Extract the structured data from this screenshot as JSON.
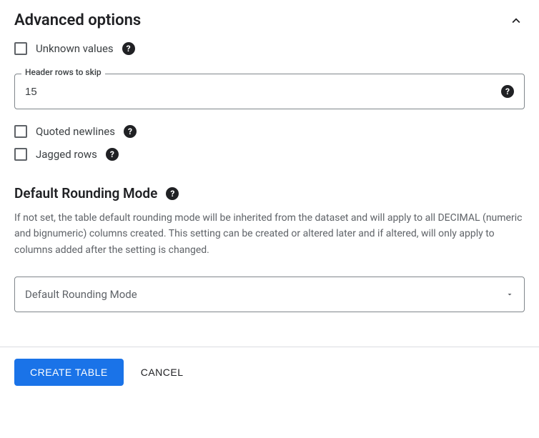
{
  "section": {
    "title": "Advanced options"
  },
  "checkboxes": {
    "unknown_values": "Unknown values",
    "quoted_newlines": "Quoted newlines",
    "jagged_rows": "Jagged rows"
  },
  "header_rows": {
    "label": "Header rows to skip",
    "value": "15"
  },
  "rounding": {
    "title": "Default Rounding Mode",
    "description": "If not set, the table default rounding mode will be inherited from the dataset and will apply to all DECIMAL (numeric and bignumeric) columns created. This setting can be created or altered later and if altered, will only apply to columns added after the setting is changed.",
    "selected": "Default Rounding Mode"
  },
  "footer": {
    "create": "Create Table",
    "cancel": "Cancel"
  }
}
